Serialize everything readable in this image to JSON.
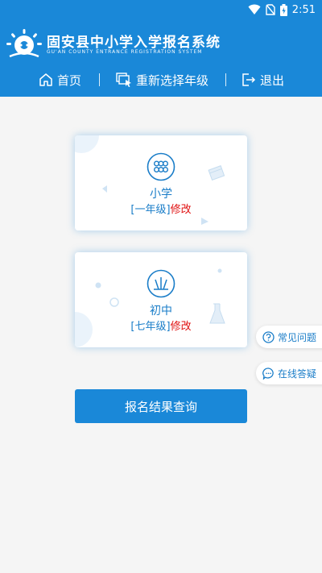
{
  "status_bar": {
    "time": "2:51"
  },
  "header": {
    "title": "固安县中小学入学报名系统",
    "subtitle": "GU'AN COUNTY ENTRANCE REGISTRATION SYSTEM"
  },
  "nav": {
    "home": "首页",
    "reselect_grade": "重新选择年级",
    "exit": "退出"
  },
  "cards": [
    {
      "name": "小学",
      "grade": "[一年级]",
      "modify": "修改"
    },
    {
      "name": "初中",
      "grade": "[七年级]",
      "modify": "修改"
    }
  ],
  "float_buttons": {
    "faq": "常见问题",
    "online_qa": "在线答疑"
  },
  "query_button": "报名结果查询",
  "colors": {
    "brand_blue": "#1a88d8",
    "text_blue": "#1a7dc8",
    "modify_red": "#e01010",
    "background": "#f5f5f5"
  },
  "icons": [
    "wifi-icon",
    "no-sim-icon",
    "battery-icon",
    "home-icon",
    "grade-select-icon",
    "exit-icon",
    "primary-school-icon",
    "junior-school-icon",
    "question-icon",
    "chat-icon"
  ]
}
